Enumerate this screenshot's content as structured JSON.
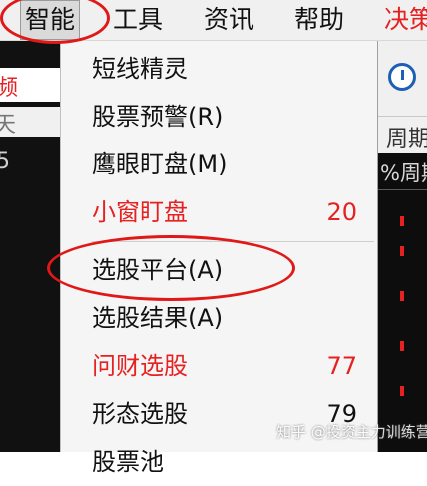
{
  "menu_bar": {
    "items": [
      {
        "label": "智能",
        "state": "open"
      },
      {
        "label": "工具"
      },
      {
        "label": "资讯"
      },
      {
        "label": "帮助"
      },
      {
        "label": "决策",
        "color": "#e52121"
      }
    ]
  },
  "background": {
    "left_glyphs": [
      "频",
      "天",
      "5"
    ],
    "right_glyphs": [
      "周期",
      "%周期"
    ]
  },
  "dropdown": {
    "items": [
      {
        "label": "短线精灵",
        "count": ""
      },
      {
        "label": "股票预警(R)",
        "count": ""
      },
      {
        "label": "鹰眼盯盘(M)",
        "count": ""
      },
      {
        "label": "小窗盯盘",
        "count": "20",
        "color": "#e52121"
      },
      {
        "label": "选股平台(A)",
        "count": ""
      },
      {
        "label": "选股结果(A)",
        "count": ""
      },
      {
        "label": "问财选股",
        "count": "77",
        "color": "#e52121"
      },
      {
        "label": "形态选股",
        "count": "79"
      },
      {
        "label": "股票池",
        "count": ""
      }
    ]
  },
  "annotations": {
    "circle_color": "#e01818"
  },
  "watermark": {
    "text": "知乎 @投资主力训练营长"
  }
}
